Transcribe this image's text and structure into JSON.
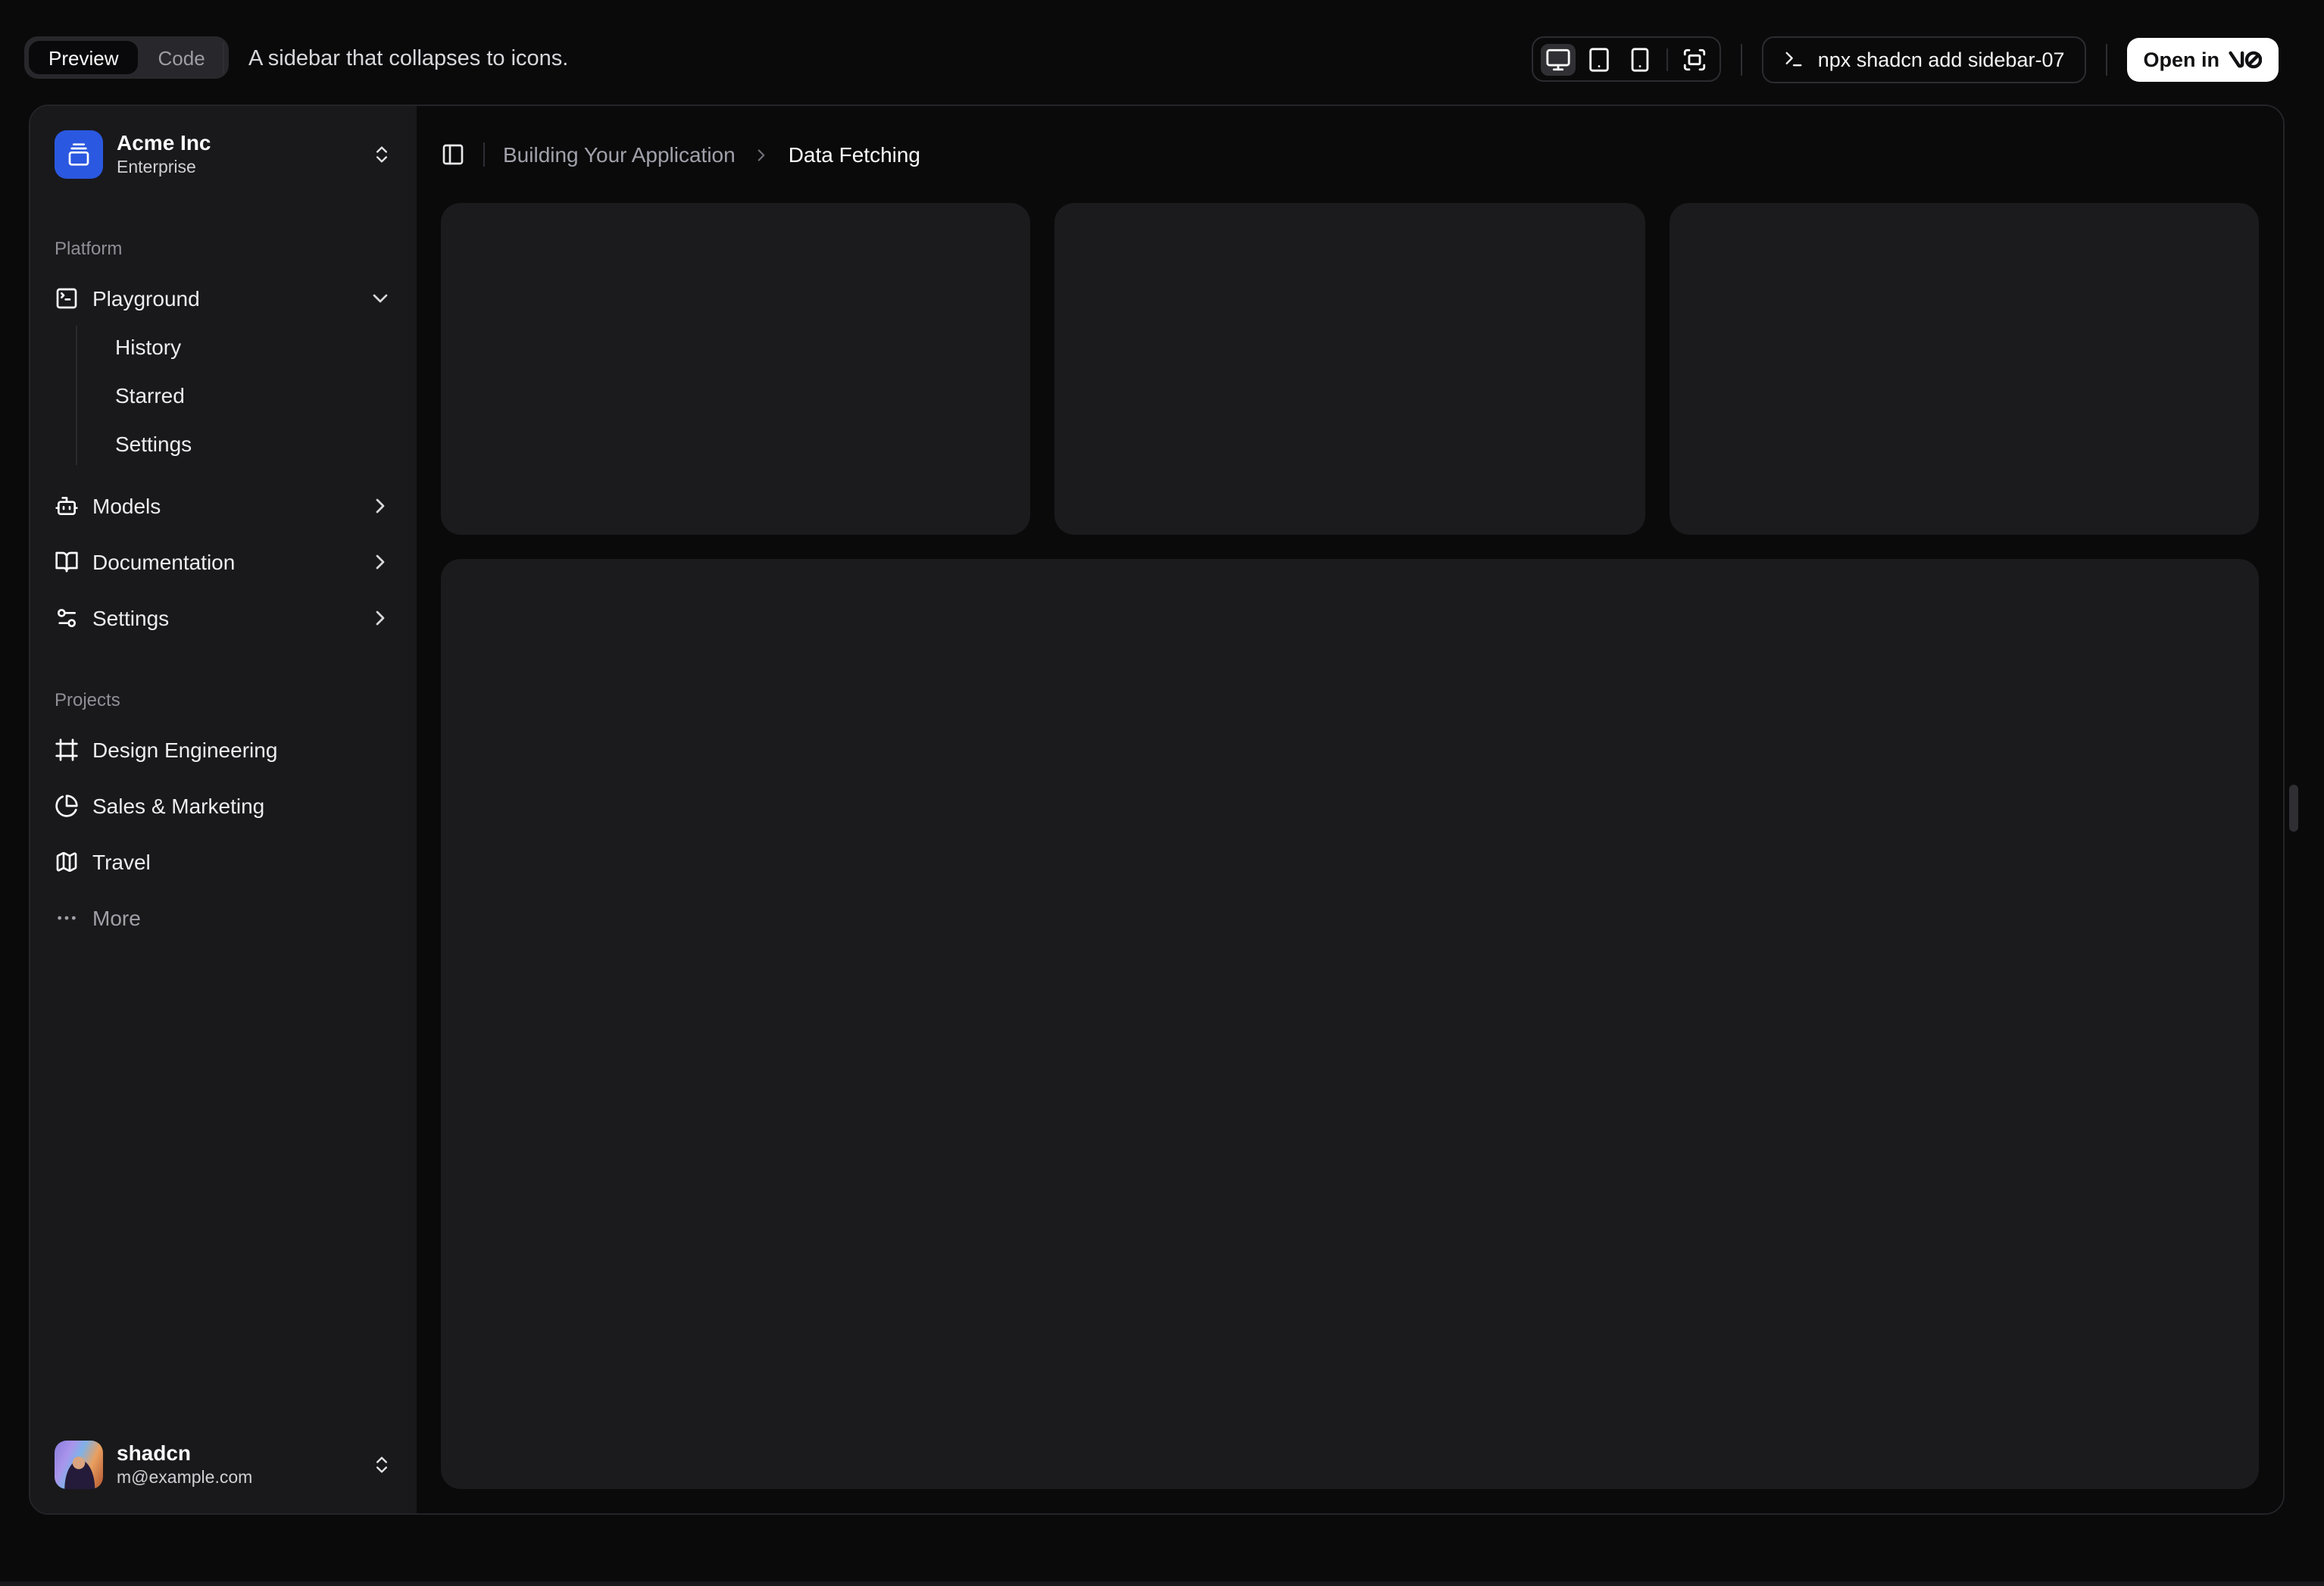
{
  "toolbar": {
    "tabs": {
      "preview": "Preview",
      "code": "Code"
    },
    "description": "A sidebar that collapses to icons.",
    "command": "npx shadcn add sidebar-07",
    "open_label": "Open in",
    "device_icons": [
      "monitor-icon",
      "tablet-icon",
      "smartphone-icon",
      "fullscreen-icon"
    ],
    "colors": {
      "open_button_bg": "#ffffff",
      "active_chip_bg": "#303034"
    }
  },
  "sidebar": {
    "org": {
      "name": "Acme Inc",
      "plan": "Enterprise",
      "logo_icon": "gallery-vertical-end-icon",
      "logo_color": "#2b58e0"
    },
    "groups": [
      {
        "label": "Platform",
        "items": [
          {
            "label": "Playground",
            "icon": "square-terminal-icon",
            "state": "expanded",
            "sub": [
              "History",
              "Starred",
              "Settings"
            ]
          },
          {
            "label": "Models",
            "icon": "bot-icon",
            "state": "collapsed"
          },
          {
            "label": "Documentation",
            "icon": "book-open-icon",
            "state": "collapsed"
          },
          {
            "label": "Settings",
            "icon": "settings-2-icon",
            "state": "collapsed"
          }
        ]
      },
      {
        "label": "Projects",
        "items": [
          {
            "label": "Design Engineering",
            "icon": "frame-icon"
          },
          {
            "label": "Sales & Marketing",
            "icon": "pie-chart-icon"
          },
          {
            "label": "Travel",
            "icon": "map-icon"
          },
          {
            "label": "More",
            "icon": "ellipsis-icon",
            "muted": true
          }
        ]
      }
    ],
    "user": {
      "name": "shadcn",
      "email": "m@example.com"
    },
    "colors": {
      "bg": "#19191c"
    }
  },
  "main": {
    "breadcrumb": {
      "parent": "Building Your Application",
      "current": "Data Fetching"
    },
    "placeholders": {
      "small_cards": 3,
      "big_card": 1,
      "card_bg": "#1b1b1e"
    }
  }
}
